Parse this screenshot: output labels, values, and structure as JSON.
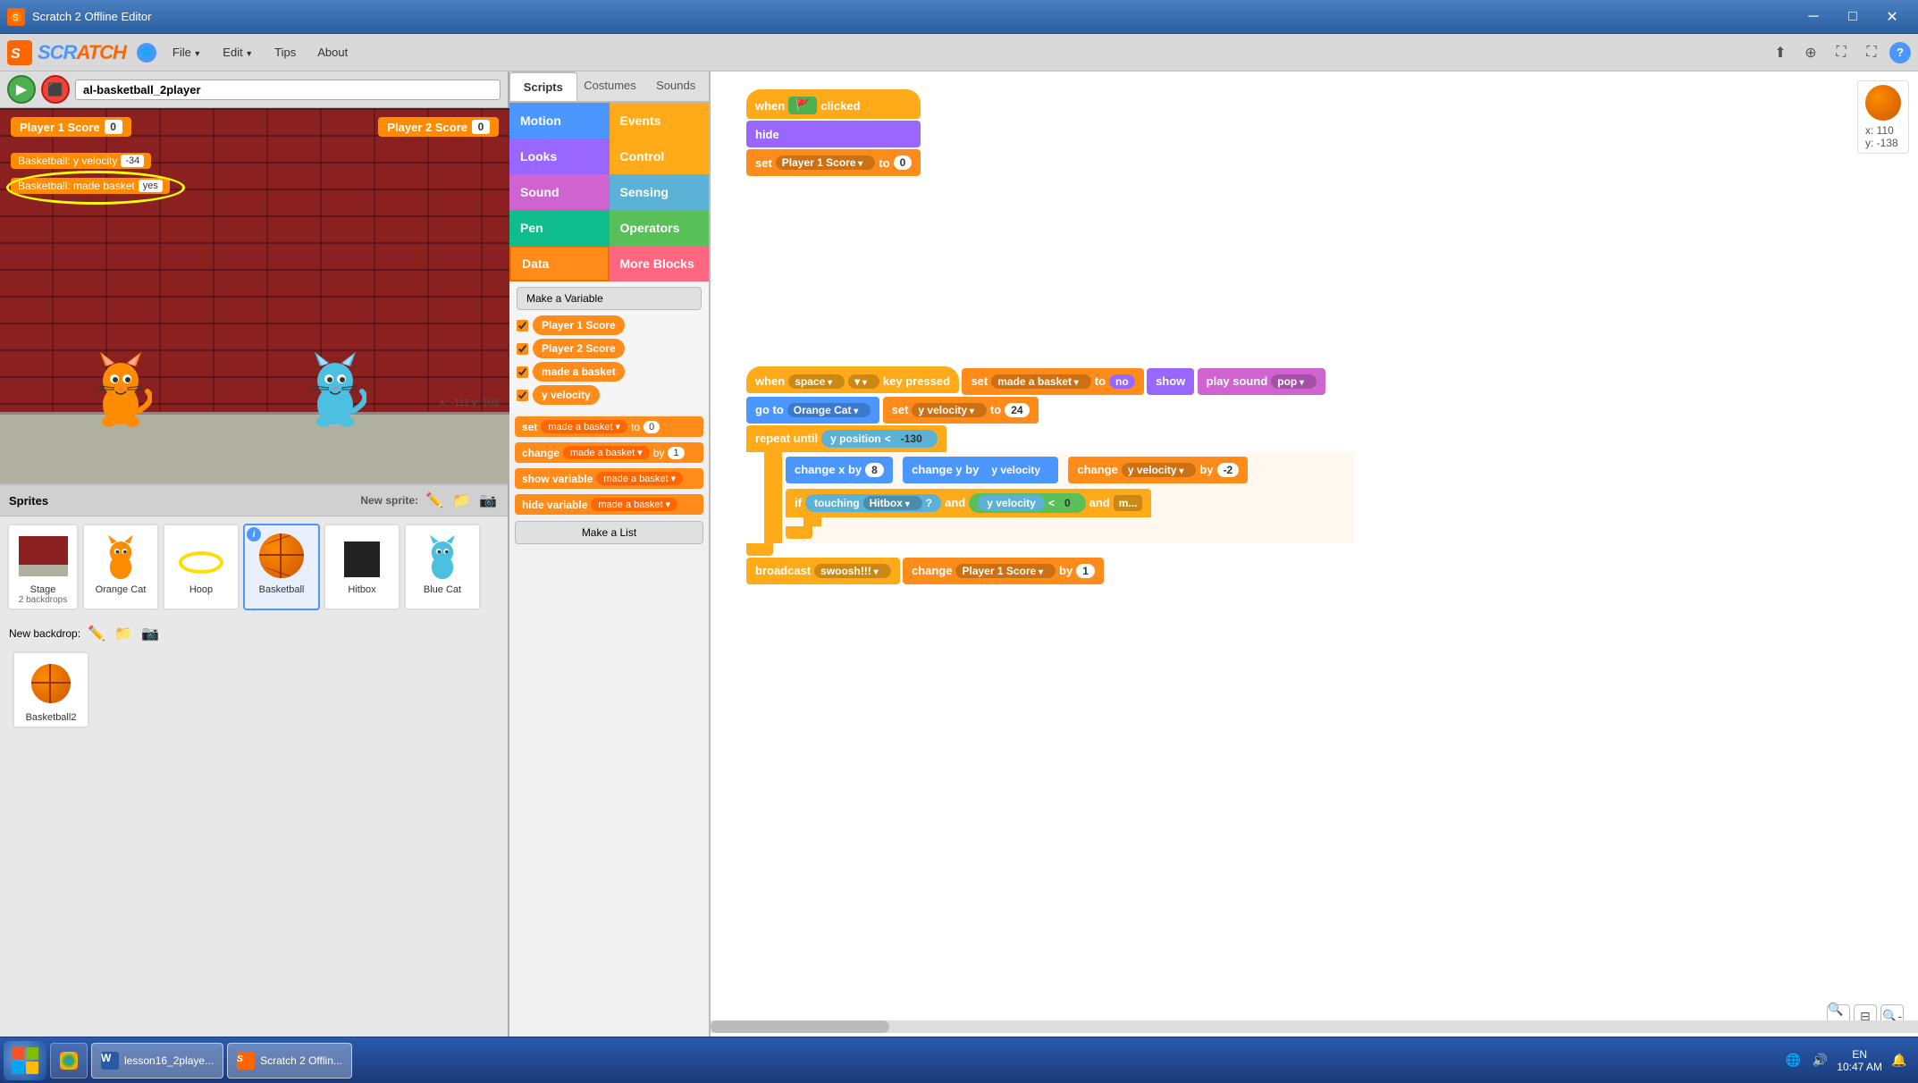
{
  "titlebar": {
    "title": "Scratch 2 Offline Editor",
    "minimize": "─",
    "maximize": "□",
    "close": "✕"
  },
  "menubar": {
    "file": "File",
    "edit": "Edit",
    "tips": "Tips",
    "about": "About"
  },
  "stage": {
    "title": "al-basketball_2player",
    "coords": "X: -111  y: 103",
    "player1_score_label": "Player 1 Score",
    "player1_score_val": "0",
    "player2_score_label": "Player 2 Score",
    "player2_score_val": "0",
    "var1_label": "Basketball: y velocity",
    "var1_val": "-34",
    "var2_label": "Basketball: made basket",
    "var2_val": "yes"
  },
  "tabs": {
    "scripts": "Scripts",
    "costumes": "Costumes",
    "sounds": "Sounds"
  },
  "categories": {
    "motion": "Motion",
    "looks": "Looks",
    "sound": "Sound",
    "pen": "Pen",
    "data": "Data",
    "events": "Events",
    "control": "Control",
    "sensing": "Sensing",
    "operators": "Operators",
    "more": "More Blocks"
  },
  "data_panel": {
    "make_var_btn": "Make a Variable",
    "vars": [
      "Player 1 Score",
      "Player 2 Score",
      "made a basket",
      "y velocity"
    ],
    "block1_label": "set",
    "block1_var": "made a basket",
    "block1_to": "0",
    "block2_label": "change",
    "block2_var": "made a basket",
    "block2_by": "1",
    "block3_label": "show variable",
    "block3_var": "made a basket",
    "block4_label": "hide variable",
    "block4_var": "made a basket",
    "make_list_btn": "Make a List"
  },
  "sprites": {
    "header": "Sprites",
    "new_sprite_label": "New sprite:",
    "stage_label": "Stage",
    "stage_sub": "2 backdrops",
    "new_backdrop_label": "New backdrop:",
    "items": [
      {
        "name": "Orange Cat",
        "selected": false
      },
      {
        "name": "Hoop",
        "selected": false
      },
      {
        "name": "Basketball",
        "selected": true
      },
      {
        "name": "Hitbox",
        "selected": false
      },
      {
        "name": "Blue Cat",
        "selected": false
      }
    ]
  },
  "blocks": {
    "when_flag_clicked": "when",
    "clicked": "clicked",
    "hide": "hide",
    "set_label": "set",
    "player1_score_var": "Player 1 Score",
    "to_label": "to",
    "set_val": "0",
    "when_space_key": "when",
    "space_key": "space",
    "key_pressed": "key  pressed",
    "set2_label": "set",
    "made_basket_var": "made a basket",
    "to_no": "no",
    "show": "show",
    "play_sound": "play sound",
    "pop": "pop",
    "go_to": "go to",
    "orange_cat": "Orange Cat",
    "set3_label": "set",
    "y_velocity_var": "y velocity",
    "to_24": "24",
    "repeat_until": "repeat until",
    "y_position": "y position",
    "lt": "<",
    "neg130": "-130",
    "change_x_by": "change  x  by",
    "x_val": "8",
    "change_y_by": "change  y  by",
    "y_velocity_ref": "y velocity",
    "change_yv_by": "change  y velocity  by",
    "neg2": "-2",
    "if_label": "if",
    "touching": "touching",
    "hitbox": "Hitbox",
    "and": "and",
    "y_velocity_lt": "y velocity",
    "lt0": "< 0",
    "and2": "and",
    "more": "m...",
    "broadcast": "broadcast",
    "swooshhh": "swoosh!!!",
    "change_p1score": "change  Player 1 Score  by",
    "by1": "1"
  },
  "taskbar": {
    "lang": "EN",
    "time": "10:47 AM",
    "app1": "lesson16_2playe...",
    "app2": "Scratch 2 Offlin..."
  },
  "sprite_coords": {
    "x": "x: 110",
    "y": "y: -138"
  }
}
